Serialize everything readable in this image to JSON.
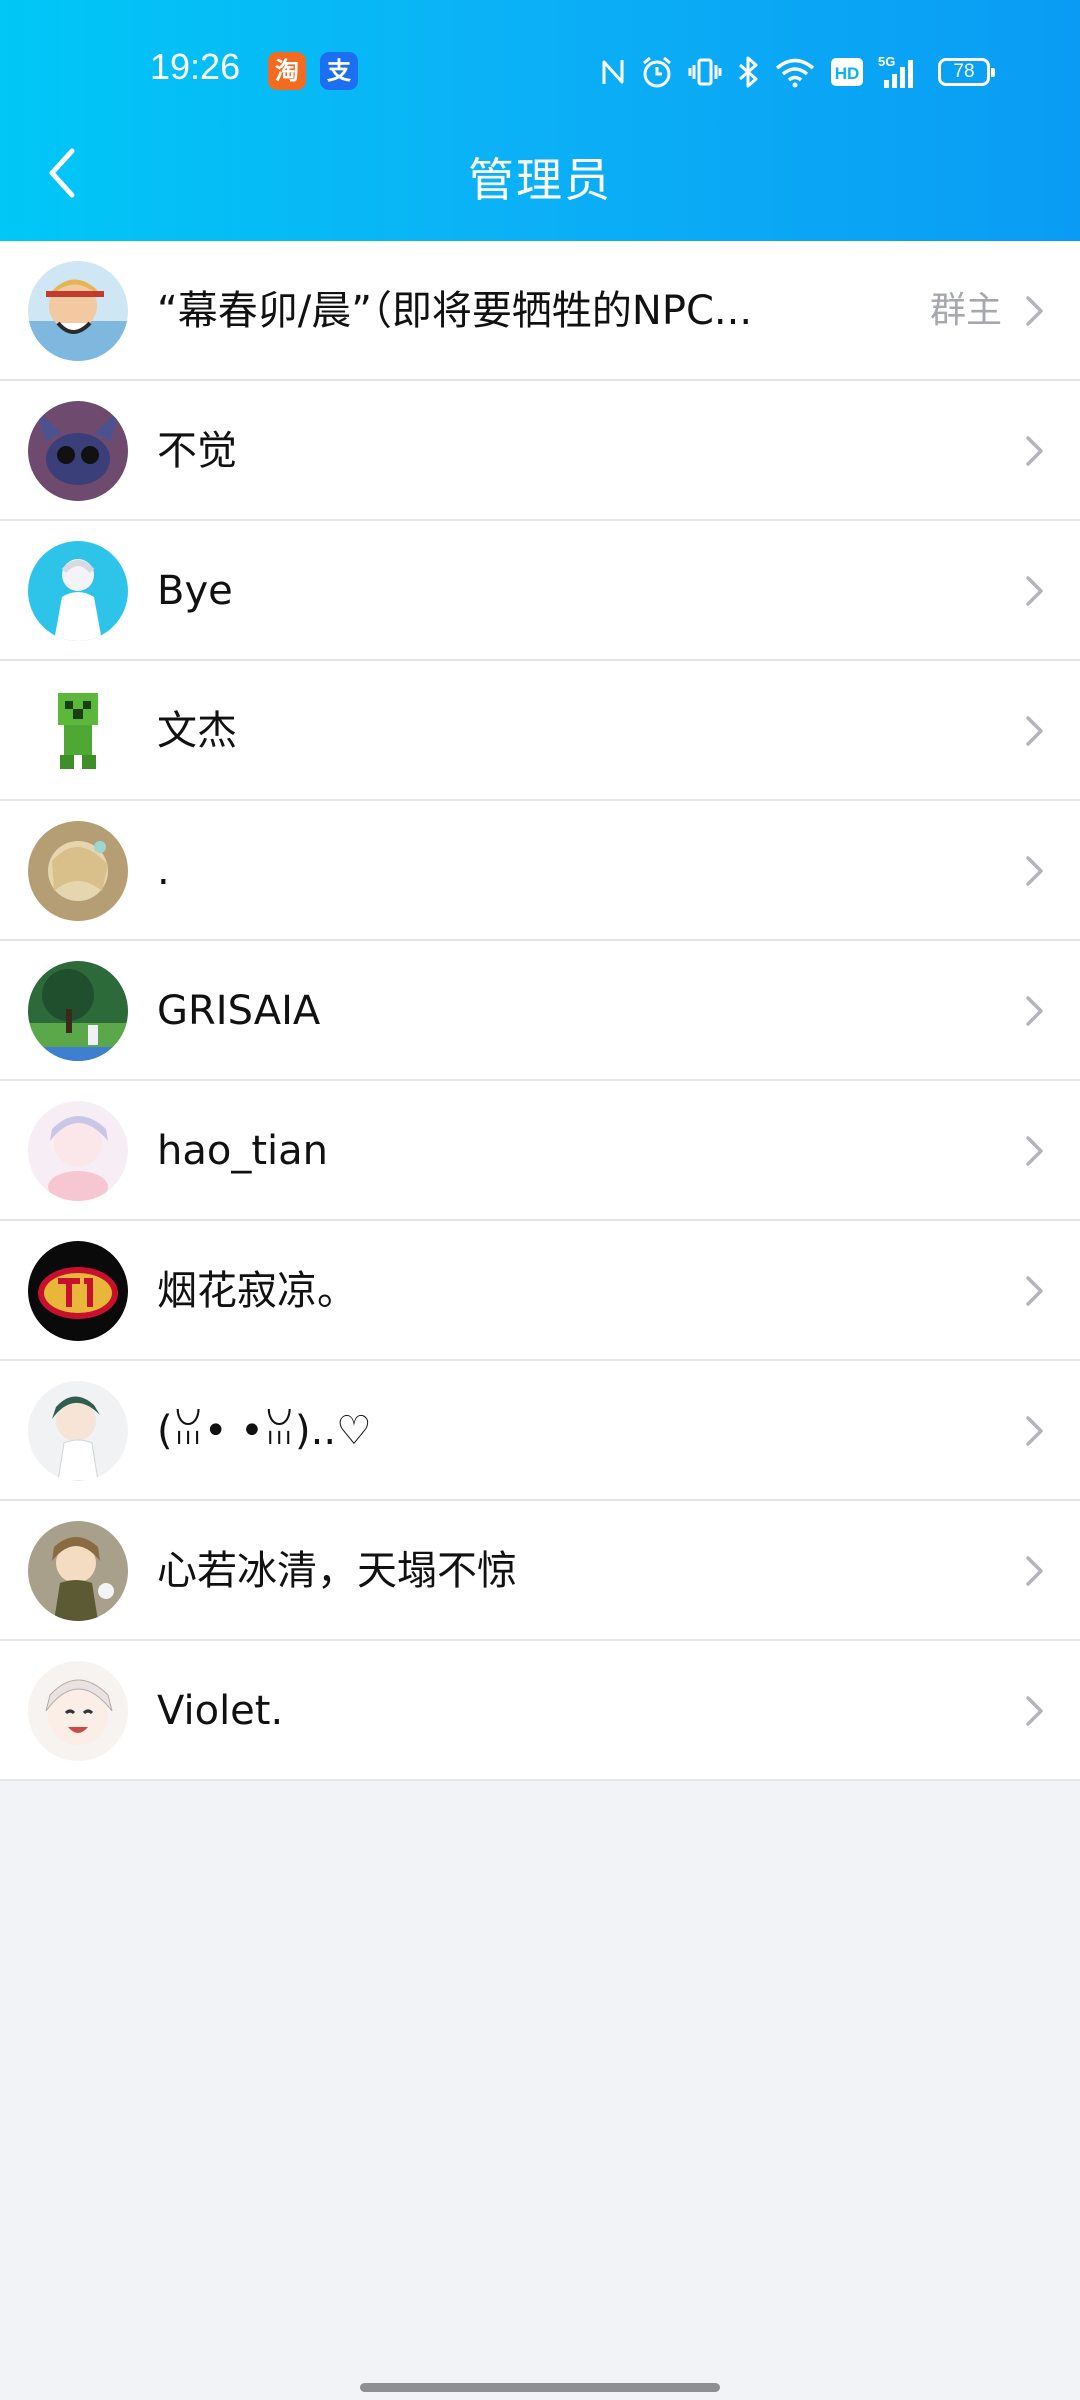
{
  "status_bar": {
    "time": "19:26",
    "app_badges": [
      {
        "icon": "taobao-icon",
        "glyph": "淘",
        "color": "#f26b20"
      },
      {
        "icon": "alipay-icon",
        "glyph": "支",
        "color": "#1d6ff2"
      }
    ],
    "icons": [
      "nfc-icon",
      "alarm-icon",
      "vibrate-icon",
      "bluetooth-icon",
      "wifi-icon",
      "hd-icon",
      "signal-5g-icon"
    ],
    "hd_label": "HD",
    "network_label": "5G",
    "battery_level": "78"
  },
  "header": {
    "title": "管理员",
    "back_icon": "back-arrow-icon",
    "gradient_colors": [
      "#00c7f6",
      "#0a9cf4"
    ]
  },
  "admins": [
    {
      "name": "“幕春卯/晨”（即将要牺牲的NPC...",
      "role": "群主"
    },
    {
      "name": "不觉",
      "role": ""
    },
    {
      "name": "Bye",
      "role": ""
    },
    {
      "name": "文杰",
      "role": ""
    },
    {
      "name": ".",
      "role": ""
    },
    {
      "name": "GRISAIA",
      "role": ""
    },
    {
      "name": "hao_tian",
      "role": ""
    },
    {
      "name": "烟花寂凉。",
      "role": ""
    },
    {
      "name": "(ꈍ• •ꈍ)..♡",
      "role": ""
    },
    {
      "name": "心若冰清，天塌不惊",
      "role": ""
    },
    {
      "name": "Violet.",
      "role": ""
    }
  ],
  "colors": {
    "page_background": "#f2f3f7",
    "divider": "#e4e5e9",
    "role_text": "#a6a8ae",
    "chevron": "#b3b5ba"
  }
}
